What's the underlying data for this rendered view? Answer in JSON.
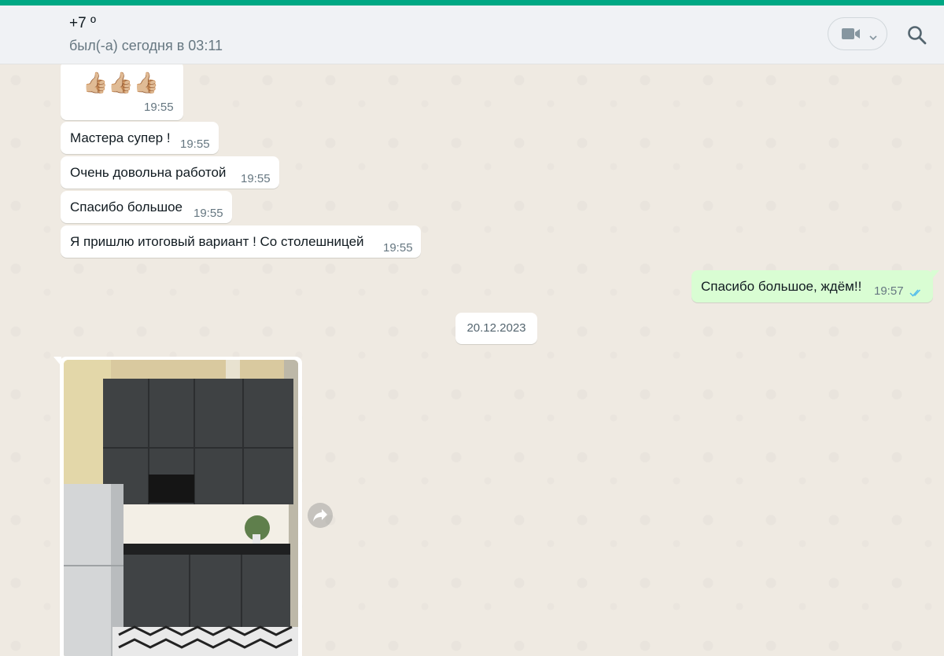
{
  "header": {
    "contact_name": "+7 º",
    "status": "был(-а) сегодня в 03:11",
    "video_icon": "video-camera-icon",
    "search_icon": "search-icon"
  },
  "colors": {
    "accent": "#00a884",
    "incoming_bubble": "#ffffff",
    "outgoing_bubble": "#d9fdd3",
    "chat_bg": "#efeae2",
    "read_ticks": "#53bdeb"
  },
  "messages": [
    {
      "direction": "in",
      "text": "👍🏼👍🏼👍🏼",
      "time": "19:55"
    },
    {
      "direction": "in",
      "text": "Мастера супер !",
      "time": "19:55"
    },
    {
      "direction": "in",
      "text": "Очень довольна работой",
      "time": "19:55"
    },
    {
      "direction": "in",
      "text": "Спасибо большое",
      "time": "19:55"
    },
    {
      "direction": "in",
      "text": "Я пришлю итоговый вариант ! Со столешницей",
      "time": "19:55"
    },
    {
      "direction": "out",
      "text": "Спасибо большое, ждём!!",
      "time": "19:57",
      "status_icon": "double-check-read-icon"
    }
  ],
  "date_separator": "20.12.2023",
  "image_message": {
    "forward_icon": "forward-icon"
  }
}
